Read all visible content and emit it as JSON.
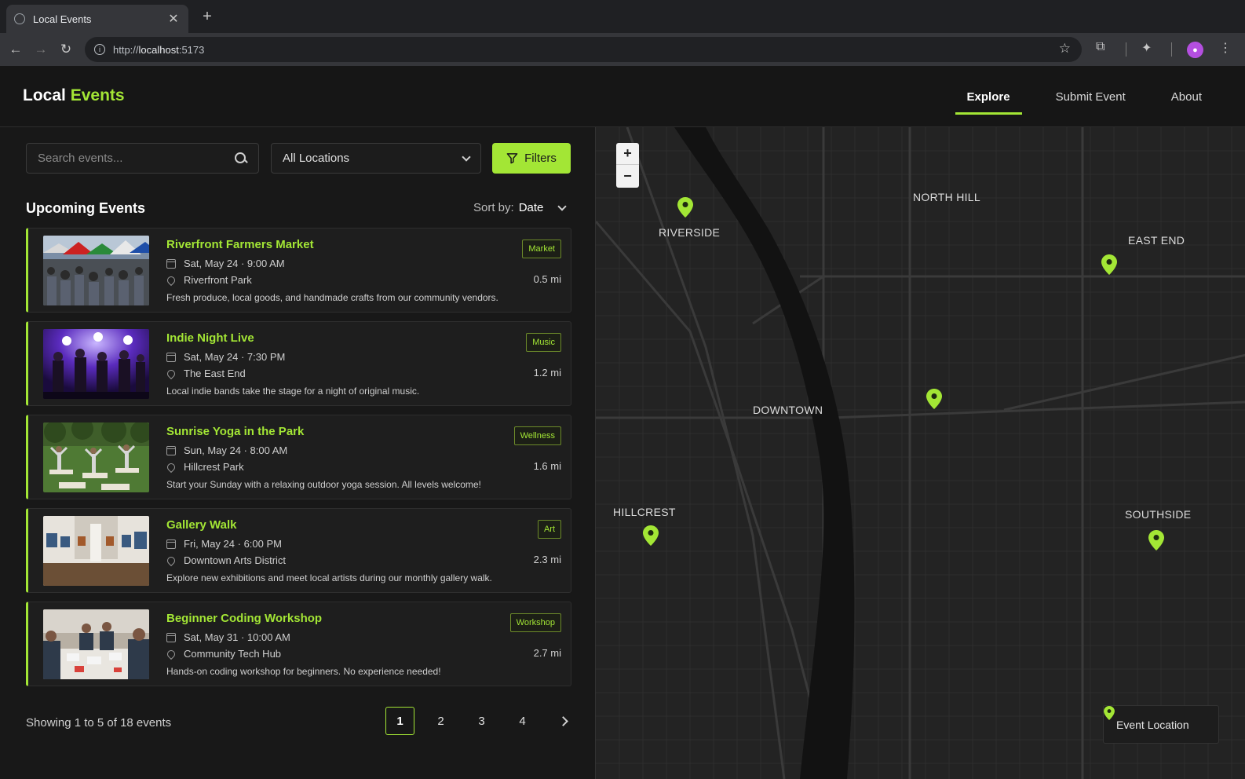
{
  "browser": {
    "tab_title": "Local Events",
    "url_prefix": "http://",
    "url_host": "localhost",
    "url_port": ":5173"
  },
  "app": {
    "logo_part1": "Local",
    "logo_part2": "Events",
    "nav": [
      {
        "label": "Explore",
        "active": true
      },
      {
        "label": "Submit Event",
        "active": false
      },
      {
        "label": "About",
        "active": false
      }
    ]
  },
  "controls": {
    "search_placeholder": "Search events...",
    "location_value": "All Locations",
    "filters_label": "Filters"
  },
  "list": {
    "title": "Upcoming Events",
    "sort_label": "Sort by:",
    "sort_value": "Date",
    "events": [
      {
        "title": "Riverfront Farmers Market",
        "date": "Sat, May 24 · 9:00 AM",
        "place": "Riverfront Park",
        "desc": "Fresh produce, local goods, and handmade crafts from our community vendors.",
        "tag": "Market",
        "distance": "0.5 mi"
      },
      {
        "title": "Indie Night Live",
        "date": "Sat, May 24 · 7:30 PM",
        "place": "The East End",
        "desc": "Local indie bands take the stage for a night of original music.",
        "tag": "Music",
        "distance": "1.2 mi"
      },
      {
        "title": "Sunrise Yoga in the Park",
        "date": "Sun, May 24 · 8:00 AM",
        "place": "Hillcrest Park",
        "desc": "Start your Sunday with a relaxing outdoor yoga session. All levels welcome!",
        "tag": "Wellness",
        "distance": "1.6 mi"
      },
      {
        "title": "Gallery Walk",
        "date": "Fri, May 24 · 6:00 PM",
        "place": "Downtown Arts District",
        "desc": "Explore new exhibitions and meet local artists during our monthly gallery walk.",
        "tag": "Art",
        "distance": "2.3 mi"
      },
      {
        "title": "Beginner Coding Workshop",
        "date": "Sat, May 31 · 10:00 AM",
        "place": "Community Tech Hub",
        "desc": "Hands-on coding workshop for beginners. No experience needed!",
        "tag": "Workshop",
        "distance": "2.7 mi"
      }
    ]
  },
  "pagination": {
    "info": "Showing 1 to 5 of 18 events",
    "pages": [
      "1",
      "2",
      "3",
      "4"
    ],
    "current": "1"
  },
  "map": {
    "districts": [
      "NORTH HILL",
      "RIVERSIDE",
      "EAST END",
      "DOWNTOWN",
      "HILLCREST",
      "SOUTHSIDE"
    ],
    "zoom_in": "+",
    "zoom_out": "−",
    "legend": "Event Location",
    "accent_color": "#a3e635"
  }
}
